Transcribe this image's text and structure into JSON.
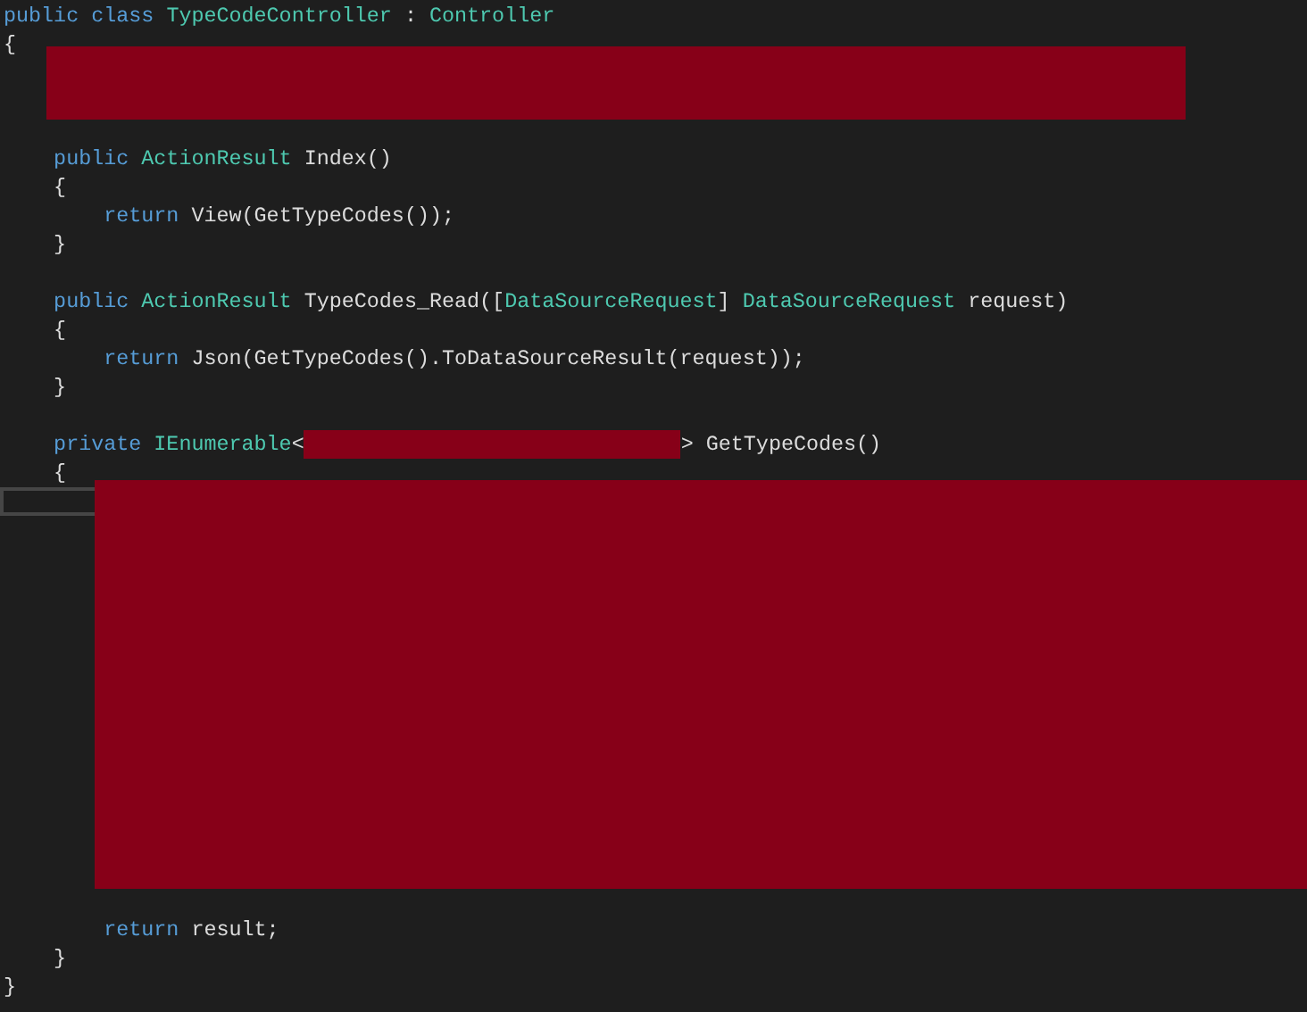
{
  "editor": {
    "lines": [
      {
        "tokens": [
          {
            "kind": "keyword",
            "text": "public class "
          },
          {
            "kind": "type",
            "text": "TypeCodeController"
          },
          {
            "kind": "plain",
            "text": " : "
          },
          {
            "kind": "type",
            "text": "Controller"
          }
        ]
      },
      {
        "tokens": [
          {
            "kind": "plain",
            "text": "{"
          }
        ]
      },
      {
        "tokens": [
          {
            "kind": "keyword",
            "text": "    public "
          },
          {
            "kind": "type",
            "text": "ActionResult"
          },
          {
            "kind": "plain",
            "text": " Index()"
          }
        ]
      },
      {
        "tokens": [
          {
            "kind": "plain",
            "text": "    {"
          }
        ]
      },
      {
        "tokens": [
          {
            "kind": "keyword",
            "text": "        return "
          },
          {
            "kind": "plain",
            "text": "View(GetTypeCodes());"
          }
        ]
      },
      {
        "tokens": [
          {
            "kind": "plain",
            "text": "    }"
          }
        ]
      },
      {
        "tokens": [
          {
            "kind": "keyword",
            "text": "    public "
          },
          {
            "kind": "type",
            "text": "ActionResult"
          },
          {
            "kind": "plain",
            "text": " TypeCodes_Read(["
          },
          {
            "kind": "type",
            "text": "DataSourceRequest"
          },
          {
            "kind": "plain",
            "text": "] "
          },
          {
            "kind": "type",
            "text": "DataSourceRequest"
          },
          {
            "kind": "plain",
            "text": " request)"
          }
        ]
      },
      {
        "tokens": [
          {
            "kind": "plain",
            "text": "    {"
          }
        ]
      },
      {
        "tokens": [
          {
            "kind": "keyword",
            "text": "        return "
          },
          {
            "kind": "plain",
            "text": "Json(GetTypeCodes().ToDataSourceResult(request));"
          }
        ]
      },
      {
        "tokens": [
          {
            "kind": "plain",
            "text": "    }"
          }
        ]
      },
      {
        "tokens": [
          {
            "kind": "keyword",
            "text": "    private "
          },
          {
            "kind": "type",
            "text": "IEnumerable"
          },
          {
            "kind": "plain",
            "text": "<"
          },
          {
            "kind": "redacted"
          },
          {
            "kind": "plain",
            "text": "> GetTypeCodes()"
          }
        ]
      },
      {
        "tokens": [
          {
            "kind": "plain",
            "text": "    {"
          }
        ]
      },
      {
        "tokens": [
          {
            "kind": "keyword",
            "text": "        return "
          },
          {
            "kind": "plain",
            "text": "result;"
          }
        ]
      },
      {
        "tokens": [
          {
            "kind": "plain",
            "text": "    }"
          }
        ]
      },
      {
        "tokens": [
          {
            "kind": "plain",
            "text": "}"
          }
        ]
      }
    ],
    "redactions": [
      {
        "kind": "block"
      },
      {
        "kind": "block"
      }
    ]
  }
}
